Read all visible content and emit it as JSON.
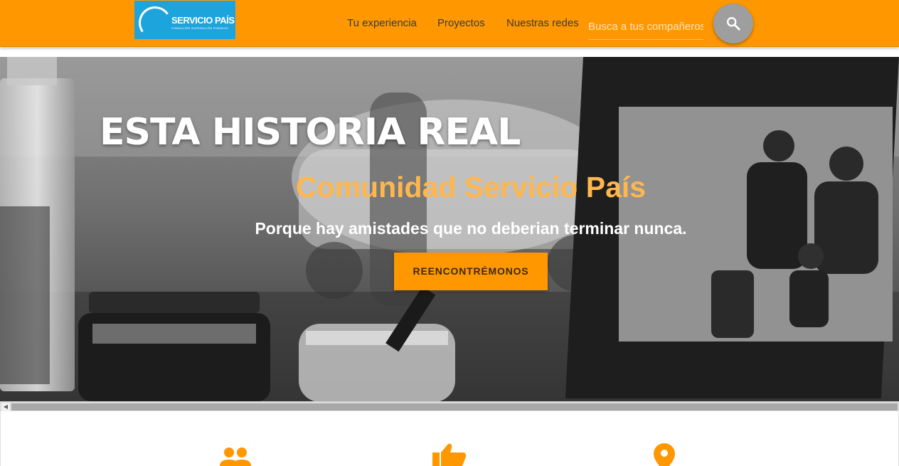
{
  "header": {
    "logo": {
      "text": "SERVICIO PAÍS",
      "subtext": "FUNDACIÓN SUPERACIÓN POBREZA"
    },
    "nav": [
      {
        "label": "Tu experiencia"
      },
      {
        "label": "Proyectos"
      },
      {
        "label": "Nuestras redes"
      }
    ],
    "search": {
      "placeholder": "Busca a tus compañeros",
      "icon": "search-icon"
    }
  },
  "hero": {
    "title": "ESTA HISTORIA REAL",
    "subtitle": "Comunidad Servicio País",
    "tagline": "Porque hay amistades que no deberian terminar nunca.",
    "cta_label": "REENCONTRÉMONOS"
  },
  "features": {
    "icons": [
      "group-icon",
      "thumbs-up-icon",
      "location-pin-icon"
    ]
  },
  "colors": {
    "accent": "#ff9800",
    "accent_light": "#ffb74d",
    "logo_blue": "#1ea4dd",
    "search_button": "#9e9e9e"
  }
}
